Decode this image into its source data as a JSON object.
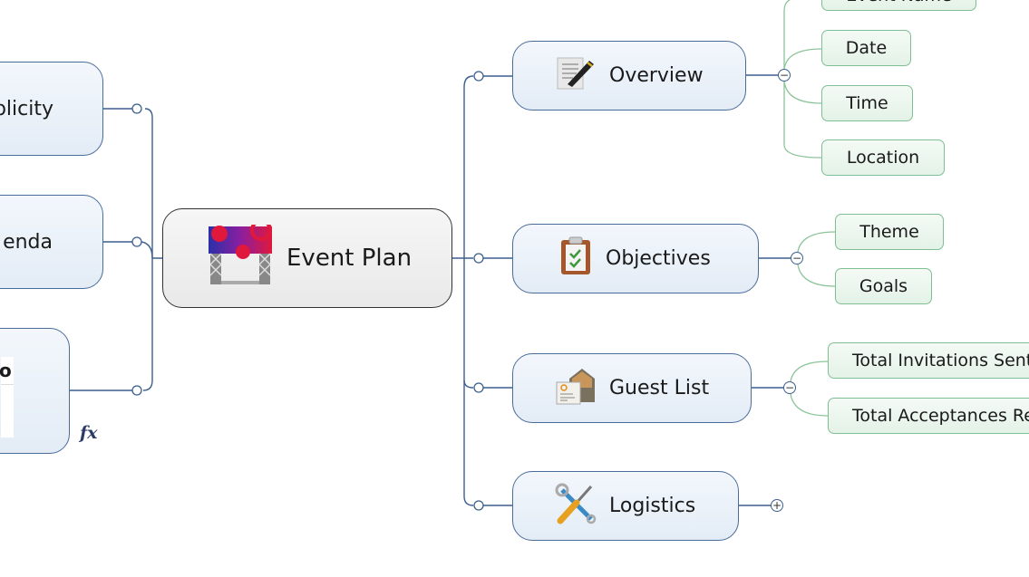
{
  "central_topic": {
    "label": "Event Plan",
    "icon": "event-stage-icon"
  },
  "left_topics": [
    {
      "label": "blicity",
      "full_label_hint": "Publicity"
    },
    {
      "label": "enda",
      "full_label_hint": "Agenda"
    },
    {
      "label": "o",
      "formula_icon": "fx"
    }
  ],
  "right_topics": [
    {
      "label": "Overview",
      "icon": "document-pen-icon",
      "toggle": "−",
      "subtopics": [
        "Event Name",
        "Date",
        "Time",
        "Location"
      ]
    },
    {
      "label": "Objectives",
      "icon": "clipboard-check-icon",
      "toggle": "−",
      "subtopics": [
        "Theme",
        "Goals"
      ]
    },
    {
      "label": "Guest List",
      "icon": "envelope-card-icon",
      "toggle": "−",
      "subtopics": [
        "Total Invitations Sent",
        "Total Acceptances Re"
      ]
    },
    {
      "label": "Logistics",
      "icon": "tools-icon",
      "toggle": "+",
      "subtopics": []
    }
  ],
  "colors": {
    "main_border": "#4a6c9b",
    "sub_border": "#7fbf93",
    "connector": "#3b5f8f",
    "sub_connector": "#8cc49a"
  }
}
